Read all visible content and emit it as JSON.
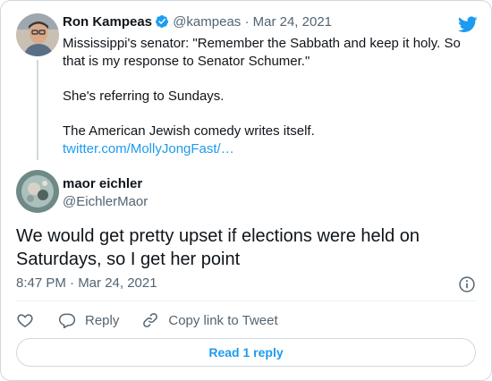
{
  "quoted_tweet": {
    "author_name": "Ron Kampeas",
    "handle_and_date": "@kampeas · Mar 24, 2021",
    "lines": [
      "Mississippi's senator: \"Remember the Sabbath and keep it holy. So",
      "that is my response to Senator Schumer.\"",
      "She's referring to Sundays.",
      "The American Jewish comedy writes itself."
    ],
    "link_text": "twitter.com/MollyJongFast/…",
    "avatar_icon": "person-photo-avatar",
    "verified_icon": "verified-badge-icon"
  },
  "main_tweet": {
    "author_name": "maor eichler",
    "handle": "@EichlerMaor",
    "text": "We would get pretty upset if elections were held on Saturdays, so I get her point",
    "timestamp": "8:47 PM · Mar 24, 2021",
    "avatar_icon": "photo-avatar"
  },
  "actions": {
    "like_icon": "heart-icon",
    "reply_label": "Reply",
    "copy_link_label": "Copy link to Tweet"
  },
  "read_replies_label": "Read 1 reply",
  "brand": {
    "logo_icon": "twitter-bird-icon",
    "accent_color": "#1d9bf0",
    "text_color": "#0f1419",
    "secondary_text_color": "#536471",
    "border_color": "#cfd9de"
  }
}
